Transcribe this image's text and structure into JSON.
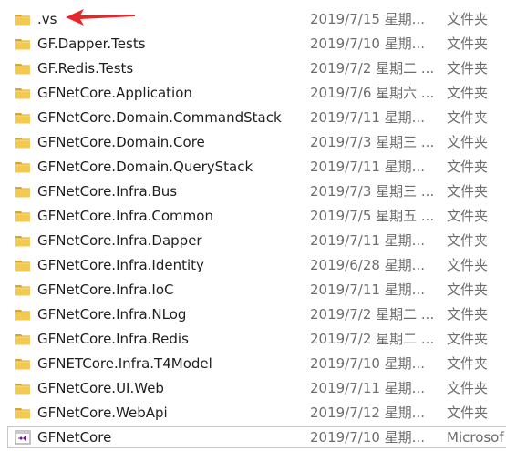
{
  "files": [
    {
      "name": ".vs",
      "date": "2019/7/15 星期...",
      "type": "文件夹",
      "icon": "folder-icon"
    },
    {
      "name": "GF.Dapper.Tests",
      "date": "2019/7/10 星期...",
      "type": "文件夹",
      "icon": "folder-icon"
    },
    {
      "name": "GF.Redis.Tests",
      "date": "2019/7/2 星期二 ...",
      "type": "文件夹",
      "icon": "folder-icon"
    },
    {
      "name": "GFNetCore.Application",
      "date": "2019/7/6 星期六 ...",
      "type": "文件夹",
      "icon": "folder-icon"
    },
    {
      "name": "GFNetCore.Domain.CommandStack",
      "date": "2019/7/11 星期...",
      "type": "文件夹",
      "icon": "folder-icon"
    },
    {
      "name": "GFNetCore.Domain.Core",
      "date": "2019/7/3 星期三 ...",
      "type": "文件夹",
      "icon": "folder-icon"
    },
    {
      "name": "GFNetCore.Domain.QueryStack",
      "date": "2019/7/11 星期...",
      "type": "文件夹",
      "icon": "folder-icon"
    },
    {
      "name": "GFNetCore.Infra.Bus",
      "date": "2019/7/3 星期三 ...",
      "type": "文件夹",
      "icon": "folder-icon"
    },
    {
      "name": "GFNetCore.Infra.Common",
      "date": "2019/7/5 星期五 ...",
      "type": "文件夹",
      "icon": "folder-icon"
    },
    {
      "name": "GFNetCore.Infra.Dapper",
      "date": "2019/7/11 星期...",
      "type": "文件夹",
      "icon": "folder-icon"
    },
    {
      "name": "GFNetCore.Infra.Identity",
      "date": "2019/6/28 星期...",
      "type": "文件夹",
      "icon": "folder-icon"
    },
    {
      "name": "GFNetCore.Infra.IoC",
      "date": "2019/7/11 星期...",
      "type": "文件夹",
      "icon": "folder-icon"
    },
    {
      "name": "GFNetCore.Infra.NLog",
      "date": "2019/7/2 星期二 ...",
      "type": "文件夹",
      "icon": "folder-icon"
    },
    {
      "name": "GFNetCore.Infra.Redis",
      "date": "2019/7/2 星期二 ...",
      "type": "文件夹",
      "icon": "folder-icon"
    },
    {
      "name": "GFNETCore.Infra.T4Model",
      "date": "2019/7/10 星期...",
      "type": "文件夹",
      "icon": "folder-icon"
    },
    {
      "name": "GFNetCore.UI.Web",
      "date": "2019/7/11 星期...",
      "type": "文件夹",
      "icon": "folder-icon"
    },
    {
      "name": "GFNetCore.WebApi",
      "date": "2019/7/12 星期...",
      "type": "文件夹",
      "icon": "folder-icon"
    },
    {
      "name": "GFNetCore",
      "date": "2019/7/10 星期...",
      "type": "Microsof",
      "icon": "visual-studio-solution-icon"
    }
  ],
  "colors": {
    "folder_main": "#f4c94f",
    "folder_dark": "#d9a72c",
    "arrow": "#e8262a",
    "vs_purple": "#68217a"
  }
}
